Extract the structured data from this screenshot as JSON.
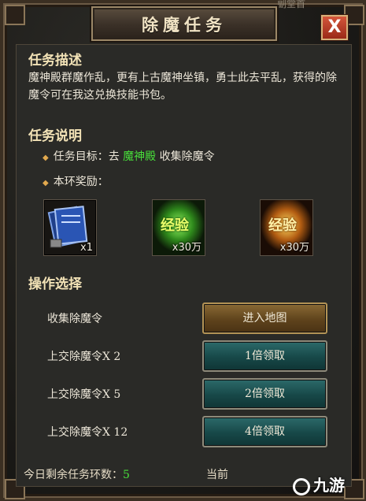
{
  "window": {
    "title": "除魔任务",
    "top_partial_text": "副堂首",
    "close_label": "X"
  },
  "description": {
    "heading": "任务描述",
    "text": "魔神殿群魔作乱，更有上古魔神坐镇，勇士此去平乱，获得的除魔令可在我这兑换技能书包。"
  },
  "instructions": {
    "heading": "任务说明",
    "goal_prefix": "任务目标：去 ",
    "goal_place": "魔神殿",
    "goal_suffix": " 收集除魔令",
    "reward_label": "本环奖励：",
    "rewards": [
      {
        "icon": "blue-book-icon",
        "quantity": "x1"
      },
      {
        "icon": "green-experience-icon",
        "text": "经验",
        "quantity": "x30万"
      },
      {
        "icon": "gold-experience-icon",
        "text": "经验",
        "quantity": "x30万"
      }
    ]
  },
  "operations": {
    "heading": "操作选择",
    "rows": [
      {
        "label": "收集除魔令",
        "button": "进入地图"
      },
      {
        "label": "上交除魔令X 2",
        "button": "1倍领取"
      },
      {
        "label": "上交除魔令X 5",
        "button": "2倍领取"
      },
      {
        "label": "上交除魔令X 12",
        "button": "4倍领取"
      }
    ]
  },
  "footer": {
    "remaining_label": "今日剩余任务环数：",
    "remaining_value": "5",
    "current_label": "当前"
  },
  "watermark": {
    "text": "九游"
  },
  "colors": {
    "accent_green": "#48df3a",
    "heading": "#f2e2b6",
    "close_red": "#c2412a"
  }
}
